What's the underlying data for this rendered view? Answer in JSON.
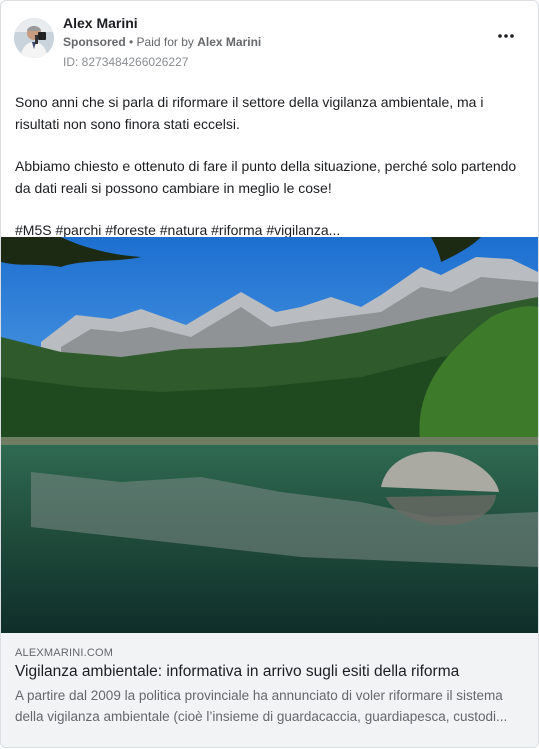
{
  "post": {
    "author_name": "Alex Marini",
    "sponsored_label": "Sponsored",
    "separator": " • ",
    "paid_for_prefix": "Paid for by ",
    "paid_for_name": "Alex Marini",
    "ad_id": "ID: 8273484266026227",
    "more_icon": "more-options-icon",
    "text_paragraph_1": "Sono anni che si parla di riformare il settore della vigilanza ambientale, ma i risultati non sono finora stati eccelsi.",
    "text_paragraph_2": "Abbiamo chiesto e ottenuto di fare il punto della situazione, perché solo partendo da dati reali si possono cambiare in meglio le cose!",
    "hashtags": "#M5S #parchi #foreste #natura #riforma #vigilanza..."
  },
  "link_preview": {
    "domain": "ALEXMARINI.COM",
    "title": "Vigilanza ambientale: informativa in arrivo sugli esiti della riforma",
    "description": "A partire dal 2009 la politica provinciale ha annunciato di voler riformare il sistema della vigilanza ambientale (cioè l’insieme di guardacaccia, guardiapesca, custodi..."
  },
  "colors": {
    "border": "#dadde1",
    "link_box_bg": "#f2f3f5",
    "secondary_text": "#65676b"
  }
}
